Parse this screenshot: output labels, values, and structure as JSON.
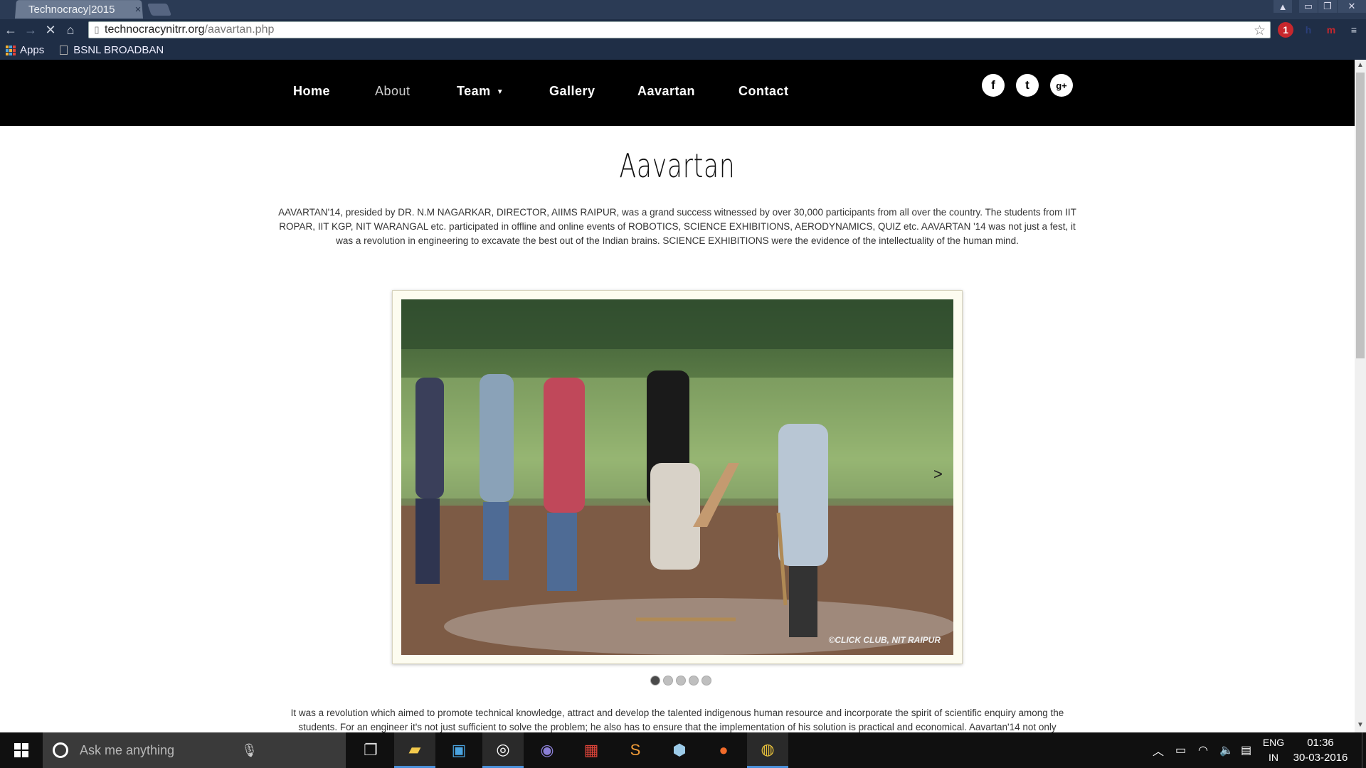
{
  "browser": {
    "tab_title": "Technocracy|2015",
    "tab_close": "×",
    "url_host": "technocracynitrr.org",
    "url_path": "/aavartan.php",
    "bookmarks": {
      "apps_label": "Apps",
      "item1": "BSNL BROADBAN"
    },
    "ext_badge": "1"
  },
  "site": {
    "nav": {
      "home": "Home",
      "about": "About",
      "team": "Team",
      "gallery": "Gallery",
      "aavartan": "Aavartan",
      "contact": "Contact"
    },
    "social": {
      "facebook": "f",
      "twitter": "t",
      "gplus": "g+"
    },
    "title": "Aavartan",
    "para1": "AAVARTAN'14, presided by DR. N.M NAGARKAR, DIRECTOR, AIIMS RAIPUR, was a grand success witnessed by over 30,000 participants from all over the country. The students from IIT ROPAR, IIT KGP, NIT WARANGAL etc. participated in offline and online events of ROBOTICS, SCIENCE EXHIBITIONS, AERODYNAMICS, QUIZ etc. AAVARTAN '14 was not just a fest, it was a revolution in engineering to excavate the best out of the Indian brains. SCIENCE EXHIBITIONS were the evidence of the intellectuality of the human mind.",
    "slider": {
      "next": ">",
      "credit": "©CLICK CLUB, NIT RAIPUR",
      "active_index": 0,
      "count": 5
    },
    "para2": "It was a revolution which aimed to promote technical knowledge, attract and develop the talented indigenous human resource and incorporate the spirit of scientific enquiry among the students. For an engineer it's not just sufficient to solve the problem; he also has to ensure that the implementation of his solution is practical and economical. Aavartan'14 not only"
  },
  "taskbar": {
    "search_placeholder": "Ask me anything",
    "lang_line1": "ENG",
    "lang_line2": "IN",
    "time": "01:36",
    "date": "30-03-2016"
  }
}
